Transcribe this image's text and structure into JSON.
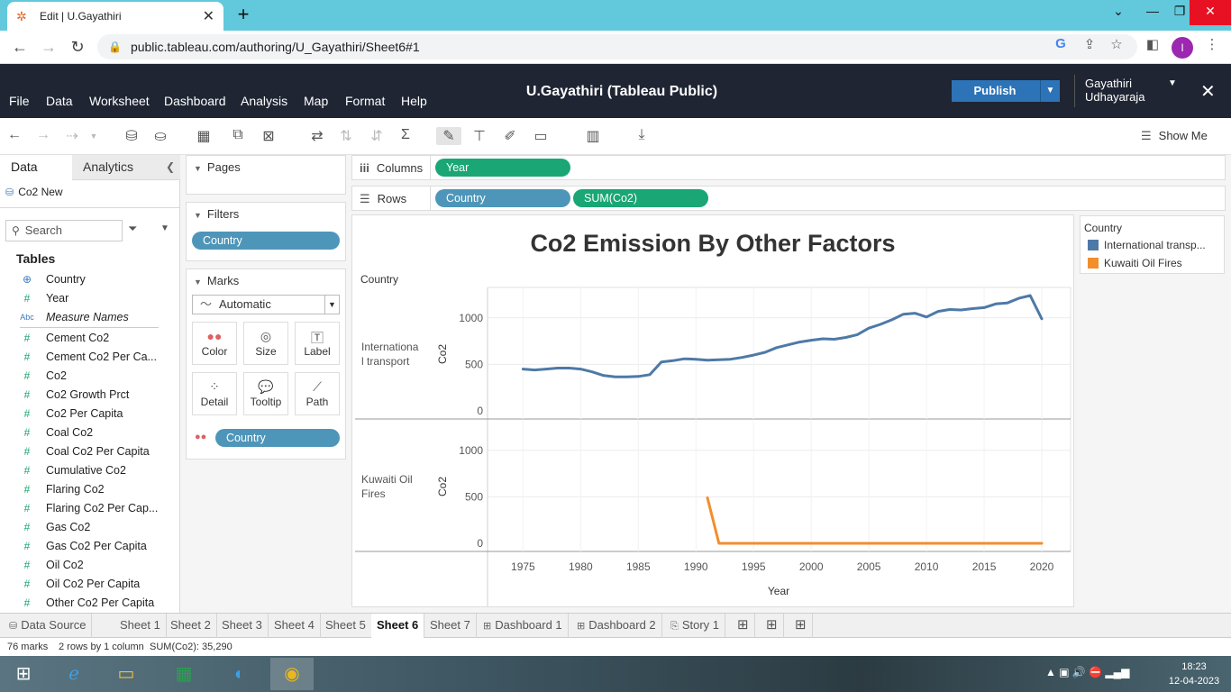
{
  "browser": {
    "tab_title": "Edit | U.Gayathiri",
    "url": "public.tableau.com/authoring/U_Gayathiri/Sheet6#1",
    "profile_initial": "I"
  },
  "header": {
    "menu": [
      "File",
      "Data",
      "Worksheet",
      "Dashboard",
      "Analysis",
      "Map",
      "Format",
      "Help"
    ],
    "workbook_title": "U.Gayathiri (Tableau Public)",
    "publish_label": "Publish",
    "user_line1": "Gayathiri",
    "user_line2": "Udhayaraja"
  },
  "toolbar": {
    "show_me": "Show Me"
  },
  "data_pane": {
    "tab_data": "Data",
    "tab_analytics": "Analytics",
    "datasource": "Co2 New",
    "search_placeholder": "Search",
    "tables_heading": "Tables",
    "dimensions": [
      {
        "label": "Country",
        "icon": "globe-icon"
      },
      {
        "label": "Year",
        "icon": "number-icon"
      }
    ],
    "measure_names": "Measure Names",
    "measures": [
      "Cement Co2",
      "Cement Co2 Per Ca...",
      "Co2",
      "Co2 Growth Prct",
      "Co2 Per Capita",
      "Coal Co2",
      "Coal Co2 Per Capita",
      "Cumulative Co2",
      "Flaring Co2",
      "Flaring Co2 Per Cap...",
      "Gas Co2",
      "Gas Co2 Per Capita",
      "Oil Co2",
      "Oil Co2 Per Capita",
      "Other Co2 Per Capita"
    ]
  },
  "cards": {
    "pages": "Pages",
    "filters": "Filters",
    "filter_pill": "Country",
    "marks": "Marks",
    "mark_type": "Automatic",
    "mark_buttons": [
      "Color",
      "Size",
      "Label",
      "Detail",
      "Tooltip",
      "Path"
    ],
    "color_pill": "Country"
  },
  "shelves": {
    "columns_label": "Columns",
    "rows_label": "Rows",
    "columns_pill": "Year",
    "rows_pills": [
      "Country",
      "SUM(Co2)"
    ]
  },
  "view": {
    "title": "Co2 Emission By Other Factors",
    "row_header": "Country",
    "legend_title": "Country",
    "legend": [
      {
        "label": "International transp...",
        "color": "#4e79a7"
      },
      {
        "label": "Kuwaiti Oil Fires",
        "color": "#f28e2b"
      }
    ]
  },
  "chart_data": {
    "type": "line",
    "title": "Co2 Emission By Other Factors",
    "xlabel": "Year",
    "ylabel": "Co2",
    "x_ticks": [
      1975,
      1980,
      1985,
      1990,
      1995,
      2000,
      2005,
      2010,
      2015,
      2020
    ],
    "y_ticks": [
      0,
      500,
      1000
    ],
    "xlim": [
      1972,
      2022.5
    ],
    "ylim": [
      0,
      1250
    ],
    "panes": [
      {
        "label_line1": "Internationa",
        "label_line2": "l transport",
        "color": "#4e79a7",
        "x": [
          1975,
          1976,
          1977,
          1978,
          1979,
          1980,
          1981,
          1982,
          1983,
          1984,
          1985,
          1986,
          1987,
          1988,
          1989,
          1990,
          1991,
          1992,
          1993,
          1994,
          1995,
          1996,
          1997,
          1998,
          1999,
          2000,
          2001,
          2002,
          2003,
          2004,
          2005,
          2006,
          2007,
          2008,
          2009,
          2010,
          2011,
          2012,
          2013,
          2014,
          2015,
          2016,
          2017,
          2018,
          2019,
          2020
        ],
        "y": [
          450,
          440,
          450,
          460,
          460,
          450,
          420,
          380,
          365,
          365,
          370,
          390,
          525,
          540,
          560,
          555,
          545,
          550,
          555,
          575,
          600,
          630,
          680,
          710,
          740,
          760,
          775,
          770,
          790,
          820,
          890,
          930,
          980,
          1040,
          1050,
          1010,
          1070,
          1090,
          1085,
          1100,
          1110,
          1150,
          1160,
          1210,
          1240,
          990
        ]
      },
      {
        "label_line1": "Kuwaiti Oil",
        "label_line2": "Fires",
        "color": "#f28e2b",
        "x": [
          1991,
          1992,
          1993,
          1994,
          1995,
          1996,
          1997,
          1998,
          1999,
          2000,
          2001,
          2002,
          2003,
          2004,
          2005,
          2006,
          2007,
          2008,
          2009,
          2010,
          2011,
          2012,
          2013,
          2014,
          2015,
          2016,
          2017,
          2018,
          2019,
          2020
        ],
        "y": [
          490,
          0,
          0,
          0,
          0,
          0,
          0,
          0,
          0,
          0,
          0,
          0,
          0,
          0,
          0,
          0,
          0,
          0,
          0,
          0,
          0,
          0,
          0,
          0,
          0,
          0,
          0,
          0,
          0,
          0
        ]
      }
    ]
  },
  "sheet_tabs": {
    "data_source": "Data Source",
    "sheets": [
      "Sheet 1",
      "Sheet 2",
      "Sheet 3",
      "Sheet 4",
      "Sheet 5",
      "Sheet 6",
      "Sheet 7",
      "Dashboard 1",
      "Dashboard 2",
      "Story 1"
    ]
  },
  "status": {
    "marks": "76 marks",
    "rows_cols": "2 rows by 1 column",
    "sum": "SUM(Co2): 35,290"
  },
  "taskbar": {
    "time": "18:23",
    "date": "12-04-2023"
  }
}
